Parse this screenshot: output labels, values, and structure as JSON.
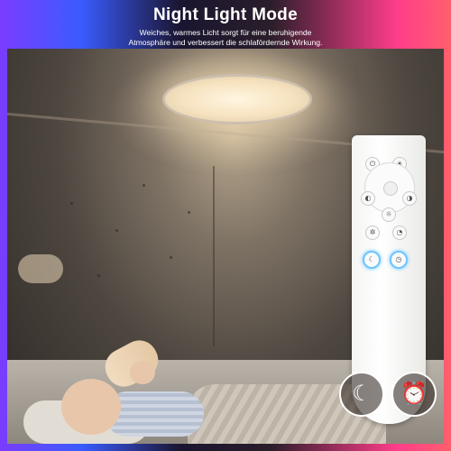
{
  "header": {
    "title": "Night Light Mode",
    "subtitle_line1": "Weiches, warmes Licht sorgt für eine beruhigende",
    "subtitle_line2": "Atmosphäre und verbessert die schlafördernde Wirkung."
  },
  "colors": {
    "gradient_left": "#7a3cff",
    "gradient_right": "#ff5f6d",
    "remote_highlight": "#6ec6ff"
  },
  "remote": {
    "buttons": [
      {
        "name": "power-icon",
        "glyph": "⏻"
      },
      {
        "name": "brightness-up-icon",
        "glyph": "☀"
      },
      {
        "name": "color-temp-left-icon",
        "glyph": "◐"
      },
      {
        "name": "color-temp-right-icon",
        "glyph": "◑"
      },
      {
        "name": "brightness-down-icon",
        "glyph": "☼"
      },
      {
        "name": "fan-icon",
        "glyph": "✲"
      },
      {
        "name": "timer-small-icon",
        "glyph": "◔"
      },
      {
        "name": "moon-small-icon",
        "glyph": "☾"
      },
      {
        "name": "clock-small-icon",
        "glyph": "◷"
      }
    ]
  },
  "badges": {
    "moon": {
      "icon": "moon-star-icon",
      "glyph": "☾"
    },
    "alarm": {
      "icon": "alarm-clock-icon",
      "glyph": "⏰"
    }
  }
}
